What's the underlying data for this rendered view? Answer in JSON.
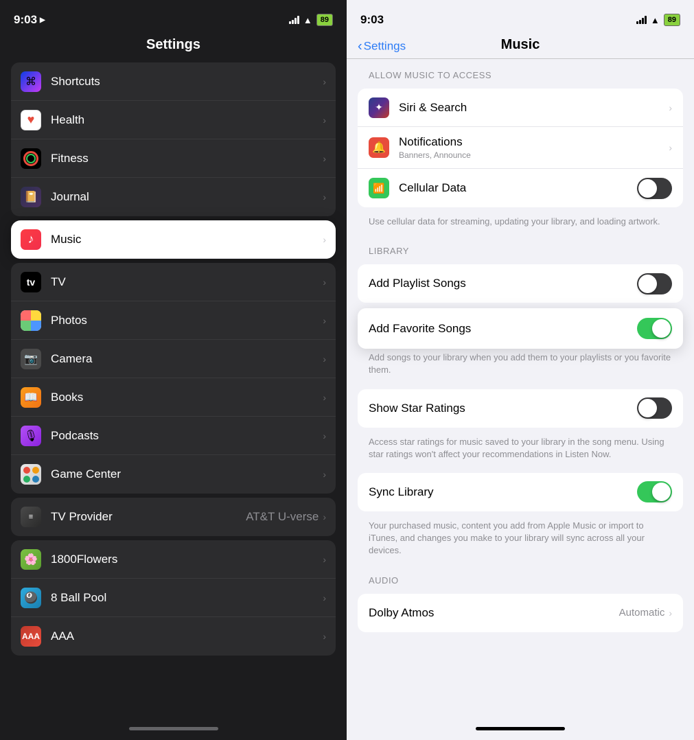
{
  "left": {
    "statusBar": {
      "time": "9:03",
      "locationIcon": "▶",
      "battery": "89"
    },
    "title": "Settings",
    "sections": [
      {
        "items": [
          {
            "id": "shortcuts",
            "label": "Shortcuts",
            "icon": "shortcuts",
            "chevron": true
          },
          {
            "id": "health",
            "label": "Health",
            "icon": "health",
            "chevron": true
          },
          {
            "id": "fitness",
            "label": "Fitness",
            "icon": "fitness",
            "chevron": true
          },
          {
            "id": "journal",
            "label": "Journal",
            "icon": "journal",
            "chevron": true
          }
        ]
      },
      {
        "highlighted": true,
        "items": [
          {
            "id": "music",
            "label": "Music",
            "icon": "music",
            "chevron": true
          }
        ]
      },
      {
        "items": [
          {
            "id": "tv",
            "label": "TV",
            "icon": "tv",
            "chevron": true
          },
          {
            "id": "photos",
            "label": "Photos",
            "icon": "photos",
            "chevron": true
          },
          {
            "id": "camera",
            "label": "Camera",
            "icon": "camera",
            "chevron": true
          },
          {
            "id": "books",
            "label": "Books",
            "icon": "books",
            "chevron": true
          },
          {
            "id": "podcasts",
            "label": "Podcasts",
            "icon": "podcasts",
            "chevron": true
          },
          {
            "id": "gamecenter",
            "label": "Game Center",
            "icon": "gamecenter",
            "chevron": true
          }
        ]
      },
      {
        "items": [
          {
            "id": "tvprovider",
            "label": "TV Provider",
            "icon": "tvprovider",
            "value": "AT&T U-verse",
            "chevron": true
          }
        ]
      },
      {
        "items": [
          {
            "id": "1800flowers",
            "label": "1800Flowers",
            "icon": "1800flowers",
            "chevron": true
          },
          {
            "id": "8ball",
            "label": "8 Ball Pool",
            "icon": "8ball",
            "chevron": true
          },
          {
            "id": "aaa",
            "label": "AAA",
            "icon": "aaa",
            "chevron": true
          }
        ]
      }
    ]
  },
  "right": {
    "statusBar": {
      "time": "9:03",
      "battery": "89"
    },
    "backLabel": "Settings",
    "title": "Music",
    "allowMusicHeader": "ALLOW MUSIC TO ACCESS",
    "allowMusicItems": [
      {
        "id": "siri",
        "label": "Siri & Search",
        "icon": "siri",
        "chevron": true
      },
      {
        "id": "notifications",
        "label": "Notifications",
        "sublabel": "Banners, Announce",
        "icon": "notifications",
        "chevron": true
      },
      {
        "id": "cellular",
        "label": "Cellular Data",
        "icon": "cellular",
        "toggle": true,
        "toggleOn": false
      }
    ],
    "cellularDescription": "Use cellular data for streaming, updating your library, and loading artwork.",
    "libraryHeader": "LIBRARY",
    "libraryItems": [
      {
        "id": "addPlaylistSongs",
        "label": "Add Playlist Songs",
        "toggle": true,
        "toggleOn": false
      },
      {
        "id": "addFavoriteSongs",
        "label": "Add Favorite Songs",
        "toggle": true,
        "toggleOn": true,
        "highlighted": true
      }
    ],
    "libraryDescription": "Add songs to your library when you add them to your playlists or you favorite them.",
    "starRatingsItem": {
      "id": "showStarRatings",
      "label": "Show Star Ratings",
      "toggle": true,
      "toggleOn": false
    },
    "starRatingsDescription": "Access star ratings for music saved to your library in the song menu. Using star ratings won't affect your recommendations in Listen Now.",
    "syncLibraryItem": {
      "id": "syncLibrary",
      "label": "Sync Library",
      "toggle": true,
      "toggleOn": true
    },
    "syncLibraryDescription": "Your purchased music, content you add from Apple Music or import to iTunes, and changes you make to your library will sync across all your devices.",
    "audioHeader": "AUDIO",
    "dolbyItem": {
      "id": "dolbyAtmos",
      "label": "Dolby Atmos",
      "value": "Automatic",
      "chevron": true
    }
  }
}
